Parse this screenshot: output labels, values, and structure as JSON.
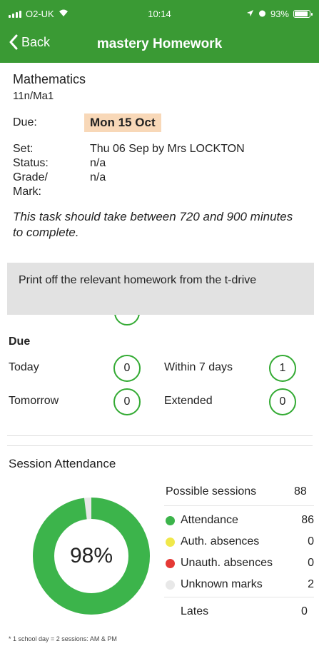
{
  "status_bar": {
    "carrier": "O2-UK",
    "time": "10:14",
    "battery": "93%",
    "battery_level": 0.93
  },
  "nav": {
    "back_label": "Back",
    "title": "mastery Homework"
  },
  "homework": {
    "subject": "Mathematics",
    "group": "11n/Ma1",
    "due_label": "Due:",
    "due_value": "Mon 15 Oct",
    "set_label": "Set:",
    "set_value": "Thu 06 Sep by Mrs LOCKTON",
    "status_label": "Status:",
    "status_value": "n/a",
    "grade_label_1": "Grade/",
    "grade_label_2": "Mark:",
    "grade_value": "n/a",
    "time_note": "This task should take between 720 and 900 minutes to complete.",
    "description": "Print off the relevant homework from the t-drive"
  },
  "due_summary": {
    "title": "Due",
    "today_label": "Today",
    "today_count": "0",
    "tomorrow_label": "Tomorrow",
    "tomorrow_count": "0",
    "week_label": "Within 7 days",
    "week_count": "1",
    "extended_label": "Extended",
    "extended_count": "0"
  },
  "attendance": {
    "title": "Session Attendance",
    "percent_label": "98%",
    "percent_value": 0.98,
    "possible_label": "Possible sessions",
    "possible_value": "88",
    "items": [
      {
        "label": "Attendance",
        "value": "86",
        "color": "#3cb44b"
      },
      {
        "label": "Auth. absences",
        "value": "0",
        "color": "#f0e84a"
      },
      {
        "label": "Unauth. absences",
        "value": "0",
        "color": "#e53935"
      },
      {
        "label": "Unknown marks",
        "value": "2",
        "color": "#e8e8e8"
      }
    ],
    "lates_label": "Lates",
    "lates_value": "0",
    "footnote": "* 1 school day = 2 sessions: AM & PM"
  },
  "colors": {
    "header_green": "#3a9a34",
    "ring_green": "#33aa33",
    "due_highlight": "#f8d8b8"
  }
}
